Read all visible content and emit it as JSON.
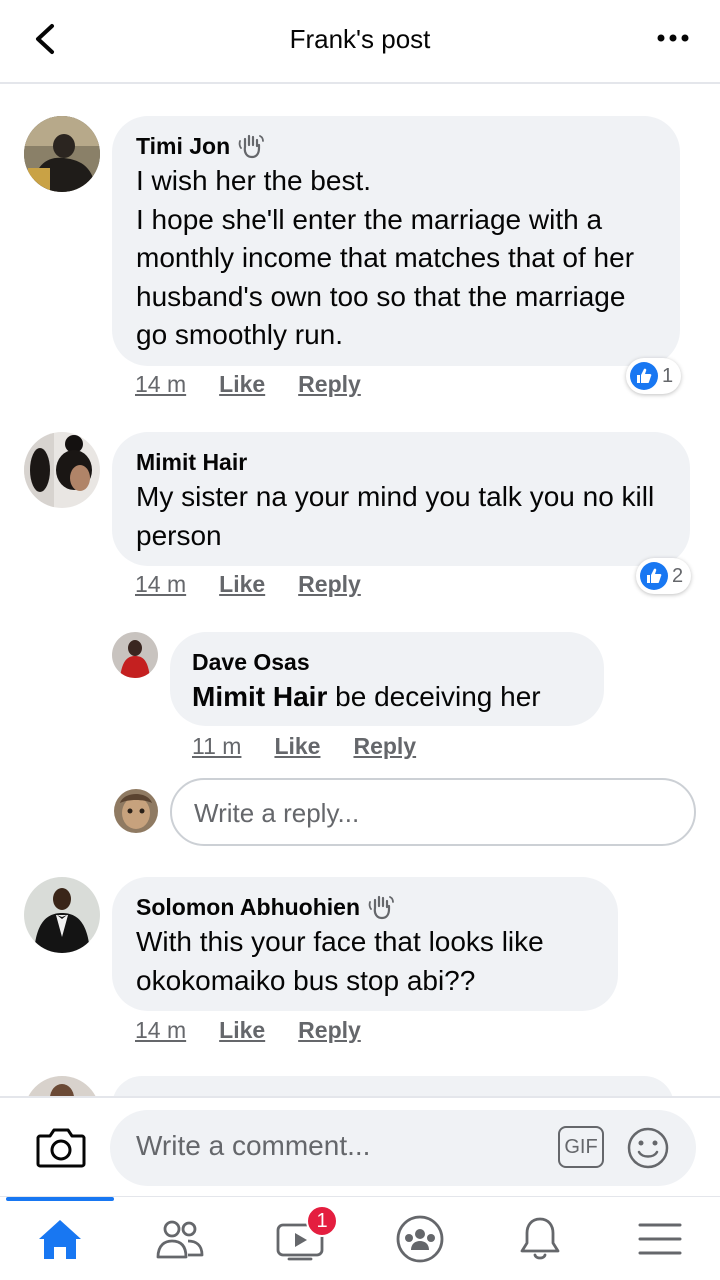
{
  "header": {
    "title": "Frank's post"
  },
  "comments": [
    {
      "author": "Timi Jon",
      "text": "I wish her the best.\nI hope she'll enter the marriage with a monthly income that matches that of her husband's own too so that the marriage go smoothly run.",
      "time": "14 m",
      "like": "Like",
      "reply": "Reply",
      "reactions": "1"
    },
    {
      "author": "Mimit Hair",
      "text": "My sister na your mind you talk you no kill person",
      "time": "14 m",
      "like": "Like",
      "reply": "Reply",
      "reactions": "2"
    },
    {
      "author": "Dave Osas",
      "mention": "Mimit Hair",
      "text": " be deceiving her",
      "time": "11 m",
      "like": "Like",
      "reply": "Reply"
    },
    {
      "author": "Solomon Abhuohien",
      "text": "With this your face that looks like okokomaiko bus stop abi??",
      "time": "14 m",
      "like": "Like",
      "reply": "Reply"
    }
  ],
  "reply_box": {
    "placeholder": "Write a reply..."
  },
  "composer": {
    "placeholder": "Write a comment...",
    "gif_label": "GIF"
  },
  "tabbar": {
    "video_badge": "1"
  },
  "colors": {
    "accent": "#1877f2",
    "badge": "#e41e3f",
    "bubble": "#f0f2f5",
    "secondary_text": "#65676b"
  }
}
